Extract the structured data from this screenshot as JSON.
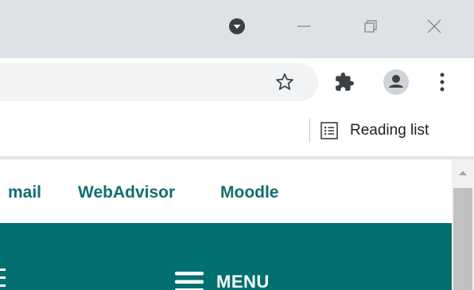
{
  "window": {
    "profile_menu_icon": "circle-chevron-down-icon",
    "minimize_icon": "minimize-icon",
    "restore_icon": "restore-icon",
    "close_icon": "close-icon"
  },
  "toolbar": {
    "bookmark_icon": "star-outline-icon",
    "extensions_icon": "puzzle-icon",
    "profile_icon": "person-icon",
    "more_icon": "vertical-dots-icon"
  },
  "bookmarks_bar": {
    "reading_list": {
      "icon": "reading-list-icon",
      "label": "Reading list"
    }
  },
  "page": {
    "nav_links": [
      "mail",
      "WebAdvisor",
      "Moodle"
    ],
    "menu": {
      "icon": "hamburger-icon",
      "label": "MENU"
    },
    "colors": {
      "brand_teal": "#027070",
      "link_teal": "#126e70"
    }
  }
}
